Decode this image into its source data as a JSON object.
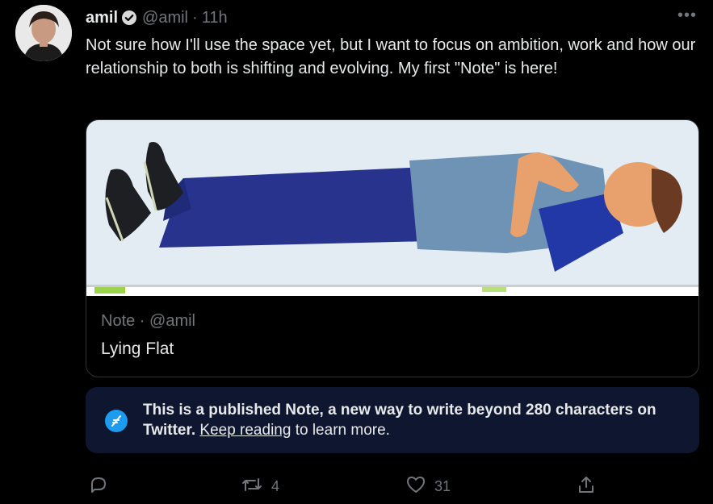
{
  "tweet": {
    "author_name": "amil",
    "author_handle": "@amil",
    "separator": "·",
    "time": "11h",
    "text": "Not sure how I'll use the space yet, but I want to focus on ambition, work and how our relationship to both is shifting and evolving. My first \"Note\" is here!",
    "more_icon": "more-horizontal-icon"
  },
  "card": {
    "meta": "Note · @amil",
    "title": "Lying Flat"
  },
  "notice": {
    "bold_text": "This is a published Note, a new way to write beyond 280 characters on Twitter.",
    "link_text": "Keep reading",
    "rest_text": " to learn more.",
    "icon": "quill-icon"
  },
  "actions": {
    "reply_count": "",
    "retweet_count": "4",
    "like_count": "31",
    "share_count": ""
  },
  "colors": {
    "background": "#000000",
    "text": "#e7e9ea",
    "muted": "#71767b",
    "accent": "#1d9bf0",
    "notice_bg": "#0f1730"
  }
}
